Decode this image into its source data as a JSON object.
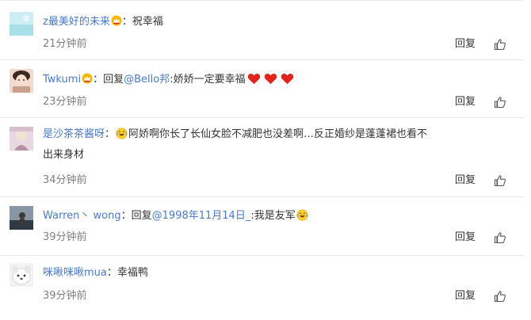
{
  "comments": [
    {
      "name": "z最美好的未来",
      "separator": "：",
      "content": "祝幸福",
      "time": "21分钟前",
      "reply": "回复"
    },
    {
      "name": "Twkumi",
      "separator": "：",
      "reply_prefix": "回复",
      "mention": "@Bello邦",
      "content": ":娇娇一定要幸福",
      "time": "23分钟前",
      "reply": "回复"
    },
    {
      "name": "是沙茶茶酱呀",
      "separator": "：",
      "content_line1": "阿娇啊你长了长仙女脸不减肥也没差啊…反正婚纱是蓬蓬裙也看不",
      "content_line2": "出来身材",
      "time": "34分钟前",
      "reply": "回复"
    },
    {
      "name": "Warren丶 wong",
      "separator": "：",
      "reply_prefix": "回复",
      "mention": "@1998年11月14日_",
      "content": ":我是友军",
      "time": "39分钟前",
      "reply": "回复"
    },
    {
      "name": "咪啾咪啾mua",
      "separator": "：",
      "content": "幸福鸭",
      "time": "39分钟前",
      "reply": "回复"
    }
  ],
  "colors": {
    "link": "#4a79c4",
    "text": "#333333",
    "meta": "#808080",
    "heart": "#e0261c"
  },
  "icons": [
    "vip-crown-icon",
    "laugh-cry-emoji-icon",
    "heart-icon",
    "thumb-up-icon"
  ]
}
